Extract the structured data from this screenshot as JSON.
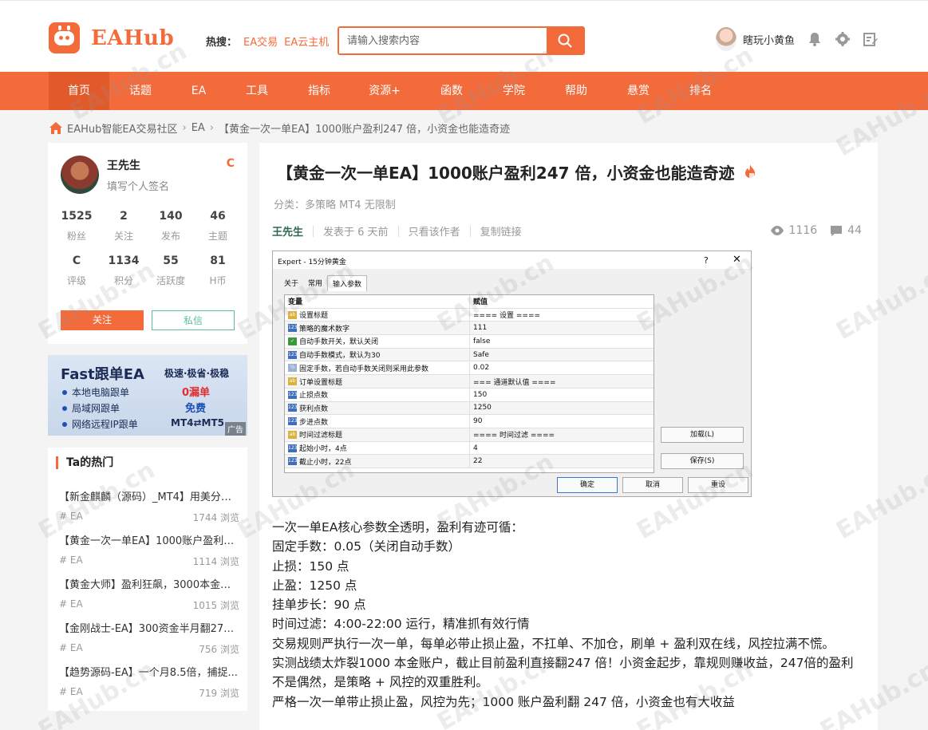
{
  "header": {
    "logo_text": "EAHub",
    "hot_label": "热搜：",
    "hot_links": [
      "EA交易",
      "EA云主机"
    ],
    "search_placeholder": "请输入搜索内容",
    "username": "瞎玩小黄鱼"
  },
  "nav": {
    "items": [
      "首页",
      "话题",
      "EA",
      "工具",
      "指标",
      "资源+",
      "函数",
      "学院",
      "帮助",
      "悬赏",
      "排名"
    ],
    "active": "首页"
  },
  "breadcrumb": [
    "EAHub智能EA交易社区",
    "EA",
    "【黄金一次一单EA】1000账户盈利247 倍，小资金也能造奇迹"
  ],
  "profile": {
    "name": "王先生",
    "signature": "填写个人签名",
    "badge": "C",
    "stats_row1": [
      {
        "value": "1525",
        "label": "粉丝"
      },
      {
        "value": "2",
        "label": "关注"
      },
      {
        "value": "140",
        "label": "发布"
      },
      {
        "value": "46",
        "label": "主题"
      }
    ],
    "stats_row2": [
      {
        "value": "C",
        "label": "评级"
      },
      {
        "value": "1134",
        "label": "积分"
      },
      {
        "value": "55",
        "label": "活跃度"
      },
      {
        "value": "81",
        "label": "H币"
      }
    ],
    "follow_label": "关注",
    "message_label": "私信"
  },
  "ad": {
    "title": "Fast跟单EA",
    "subtitle": "极速·极省·极稳",
    "rows": [
      {
        "label": "本地电脑跟单",
        "value": "0漏单"
      },
      {
        "label": "局域网跟单",
        "value": "免费"
      },
      {
        "label": "网络远程IP跟单",
        "value": "MT4⇄MT5"
      }
    ],
    "tag": "广告"
  },
  "hotlist": {
    "title": "Ta的热门",
    "items": [
      {
        "title": "【新金麒麟（源码）_MT4】用美分跑...",
        "tag": "# EA",
        "views": "1744 浏览"
      },
      {
        "title": "【黄金一次一单EA】1000账户盈利2...",
        "tag": "# EA",
        "views": "1114 浏览"
      },
      {
        "title": "【黄金大师】盈利狂飙，3000本金干...",
        "tag": "# EA",
        "views": "1015 浏览"
      },
      {
        "title": "【金刚战士-EA】300资金半月翻27倍...",
        "tag": "# EA",
        "views": "756 浏览"
      },
      {
        "title": "【趋势源码-EA】一个月8.5倍，捕捉...",
        "tag": "# EA",
        "views": "719 浏览"
      }
    ]
  },
  "article": {
    "title": "【黄金一次一单EA】1000账户盈利247 倍，小资金也能造奇迹",
    "category": "分类：多策略 MT4 无限制",
    "author": "王先生",
    "posted": "发表于 6 天前",
    "only_author": "只看该作者",
    "copy_link": "复制链接",
    "views": "1116",
    "comments": "44",
    "paragraphs": [
      "一次一单EA核心参数全透明，盈利有迹可循：",
      "固定手数：0.05（关闭自动手数）",
      "止损：150 点",
      "止盈：1250 点",
      "挂单步长：90 点",
      "时间过滤：4:00-22:00 运行，精准抓有效行情",
      "交易规则严执行一次一单，每单必带止损止盈，不扛单、不加仓，刷单 + 盈利双在线，风控拉满不慌。",
      "实测战绩太炸裂1000 本金账户，截止目前盈利直接翻247 倍！小资金起步，靠规则赚收益，247倍的盈利不是偶然，是策略 + 风控的双重胜利。",
      "严格一次一单带止损止盈，风控为先；1000 账户盈利翻 247 倍，小资金也有大收益"
    ]
  },
  "dialog": {
    "title": "Expert - 15分钟黄金",
    "help": "?",
    "close": "✕",
    "tabs": [
      "关于",
      "常用",
      "输入参数"
    ],
    "header": {
      "k": "变量",
      "v": "赋值"
    },
    "rows": [
      {
        "icon": "ab",
        "k": "设置标题",
        "v": "==== 设置 ===="
      },
      {
        "icon": "123",
        "k": "策略的魔术数字",
        "v": "111"
      },
      {
        "icon": "bool",
        "k": "自动手数开关，默认关闭",
        "v": "false"
      },
      {
        "icon": "123",
        "k": "自动手数模式，默认为30",
        "v": "Safe"
      },
      {
        "icon": "1/2",
        "k": "固定手数，若自动手数关闭则采用此参数",
        "v": "0.02"
      },
      {
        "icon": "ab",
        "k": "订单设置标题",
        "v": "=== 通道默认值 ===="
      },
      {
        "icon": "123",
        "k": "止损点数",
        "v": "150"
      },
      {
        "icon": "123",
        "k": "获利点数",
        "v": "1250"
      },
      {
        "icon": "123",
        "k": "步进点数",
        "v": "90"
      },
      {
        "icon": "ab",
        "k": "时间过滤标题",
        "v": "==== 时间过滤 ===="
      },
      {
        "icon": "123",
        "k": "起始小时，4点",
        "v": "4"
      },
      {
        "icon": "123",
        "k": "截止小时，22点",
        "v": "22"
      }
    ],
    "side_buttons": [
      "加载(L)",
      "保存(S)"
    ],
    "bottom_buttons": [
      "确定",
      "取消",
      "重设"
    ]
  },
  "watermark": "EAHub.cn"
}
